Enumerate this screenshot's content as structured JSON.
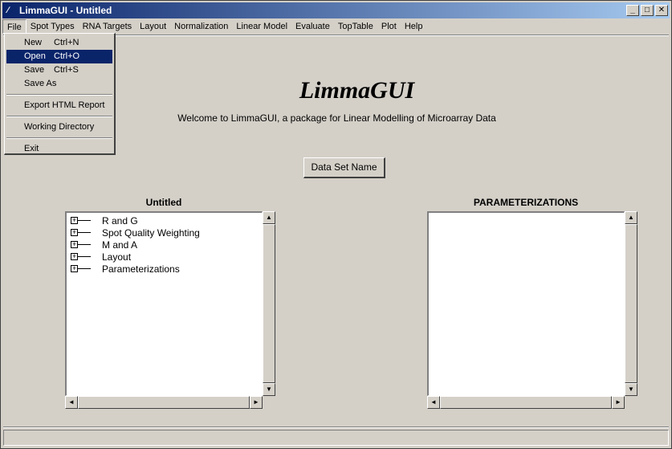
{
  "window": {
    "title": "LimmaGUI - Untitled",
    "minimize_glyph": "_",
    "maximize_glyph": "□",
    "close_glyph": "✕"
  },
  "menubar": {
    "items": [
      "File",
      "Spot Types",
      "RNA Targets",
      "Layout",
      "Normalization",
      "Linear Model",
      "Evaluate",
      "TopTable",
      "Plot",
      "Help"
    ]
  },
  "file_menu": {
    "new": {
      "label": "New",
      "shortcut": "Ctrl+N"
    },
    "open": {
      "label": "Open",
      "shortcut": "Ctrl+O"
    },
    "save": {
      "label": "Save",
      "shortcut": "Ctrl+S"
    },
    "save_as": {
      "label": "Save As"
    },
    "export": {
      "label": "Export HTML Report"
    },
    "working_dir": {
      "label": "Working Directory"
    },
    "exit": {
      "label": "Exit"
    }
  },
  "main": {
    "app_title": "LimmaGUI",
    "welcome": "Welcome to LimmaGUI, a package for Linear Modelling of Microarray Data",
    "dataset_button": "Data Set Name"
  },
  "left_panel": {
    "title": "Untitled",
    "tree": [
      "R and G",
      "Spot Quality Weighting",
      "M and A",
      "Layout",
      "Parameterizations"
    ]
  },
  "right_panel": {
    "title": "PARAMETERIZATIONS"
  },
  "icons": {
    "expand": "+",
    "scroll_up": "▲",
    "scroll_down": "▼",
    "scroll_left": "◄",
    "scroll_right": "►"
  },
  "colors": {
    "titlebar": "#0a246a",
    "highlight": "#0a246a",
    "face": "#d4d0c8"
  }
}
